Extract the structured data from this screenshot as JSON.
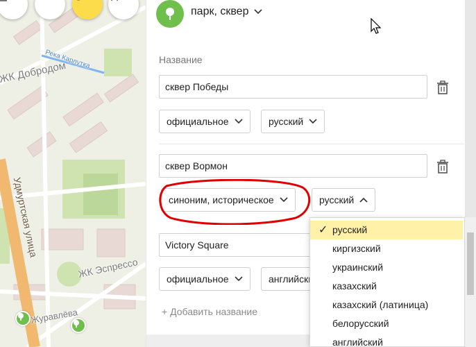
{
  "map": {
    "labels": {
      "district": "ЖК Добродом",
      "river": "Река Карлутка",
      "street": "Удмуртская улица",
      "complex": "ЖК Эспрессо",
      "building": "Журавлёва"
    },
    "tools": [
      "trash-icon",
      "line-icon",
      "magnet-icon",
      "sliders-icon"
    ]
  },
  "panel": {
    "category": "парк, сквер",
    "section_label": "Название",
    "names": [
      {
        "value": "сквер Победы",
        "type": "официальное",
        "language": "русский"
      },
      {
        "value": "сквер Вормон",
        "type": "синоним, историческое",
        "language": "русский"
      },
      {
        "value": "Victory Square",
        "type": "официальное",
        "language": "английский"
      }
    ],
    "add_name": "+ Добавить название"
  },
  "dropdown": {
    "check": "✓",
    "options": [
      "русский",
      "киргизский",
      "украинский",
      "казахский",
      "казахский (латиница)",
      "белорусский",
      "английский"
    ],
    "selected_index": 0
  },
  "colors": {
    "park_green": "#6fbf4c",
    "highlight": "#fff1a8",
    "annotation_red": "#e00000",
    "active_tool": "#fddc4c"
  }
}
